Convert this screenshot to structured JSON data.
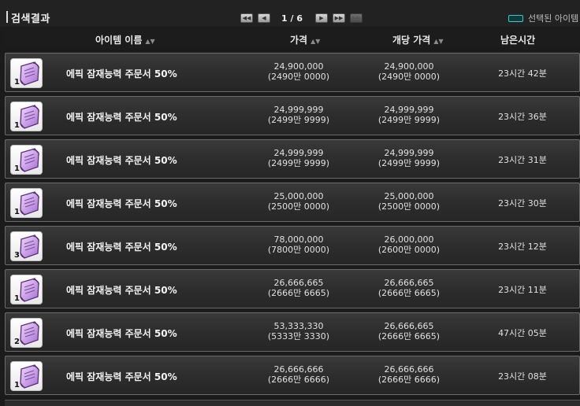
{
  "title": "검색결과",
  "pagination": {
    "first_label": "◀◀",
    "prev_label": "◀",
    "text": "1 / 6",
    "next_label": "▶",
    "last_label": "▶▶",
    "more_label": "▶▶"
  },
  "selected_filter": {
    "label": "선택된 아이템",
    "color": "#38c9c9"
  },
  "columns": {
    "name": "아이템 이름",
    "price": "가격",
    "unit_price": "개당 가격",
    "time_left": "남은시간",
    "sort_icon": "▲▼"
  },
  "rows": [
    {
      "qty": "1",
      "name": "에픽 잠재능력 주문서 50%",
      "price": "24,900,000",
      "price_sub": "(2490만 0000)",
      "unit": "24,900,000",
      "unit_sub": "(2490만 0000)",
      "time": "23시간 42분"
    },
    {
      "qty": "1",
      "name": "에픽 잠재능력 주문서 50%",
      "price": "24,999,999",
      "price_sub": "(2499만 9999)",
      "unit": "24,999,999",
      "unit_sub": "(2499만 9999)",
      "time": "23시간 36분"
    },
    {
      "qty": "1",
      "name": "에픽 잠재능력 주문서 50%",
      "price": "24,999,999",
      "price_sub": "(2499만 9999)",
      "unit": "24,999,999",
      "unit_sub": "(2499만 9999)",
      "time": "23시간 31분"
    },
    {
      "qty": "1",
      "name": "에픽 잠재능력 주문서 50%",
      "price": "25,000,000",
      "price_sub": "(2500만 0000)",
      "unit": "25,000,000",
      "unit_sub": "(2500만 0000)",
      "time": "23시간 30분"
    },
    {
      "qty": "3",
      "name": "에픽 잠재능력 주문서 50%",
      "price": "78,000,000",
      "price_sub": "(7800만 0000)",
      "unit": "26,000,000",
      "unit_sub": "(2600만 0000)",
      "time": "23시간 12분"
    },
    {
      "qty": "1",
      "name": "에픽 잠재능력 주문서 50%",
      "price": "26,666,665",
      "price_sub": "(2666만 6665)",
      "unit": "26,666,665",
      "unit_sub": "(2666만 6665)",
      "time": "23시간 11분"
    },
    {
      "qty": "2",
      "name": "에픽 잠재능력 주문서 50%",
      "price": "53,333,330",
      "price_sub": "(5333만 3330)",
      "unit": "26,666,665",
      "unit_sub": "(2666만 6665)",
      "time": "47시간 05분"
    },
    {
      "qty": "1",
      "name": "에픽 잠재능력 주문서 50%",
      "price": "26,666,666",
      "price_sub": "(2666만 6666)",
      "unit": "26,666,666",
      "unit_sub": "(2666만 6666)",
      "time": "23시간 08분"
    }
  ],
  "icon": {
    "name": "scroll-icon",
    "color": "#c89ce0"
  }
}
